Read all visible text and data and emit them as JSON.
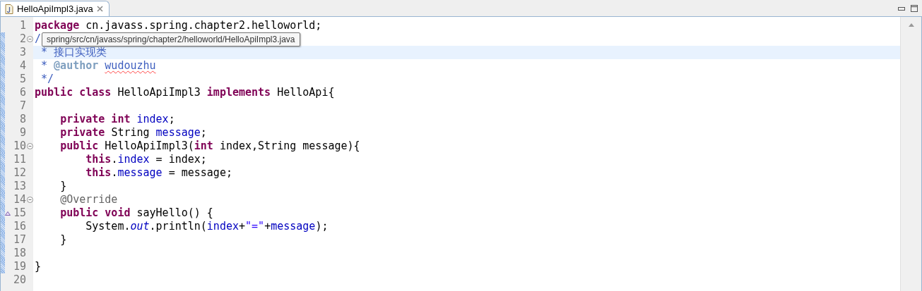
{
  "tab": {
    "title": "HelloApiImpl3.java",
    "selected": true
  },
  "tooltip": "spring/src/cn/javass/spring/chapter2/helloworld/HelloApiImpl3.java",
  "lines": [
    {
      "number": "1",
      "selected": false,
      "changed": false,
      "fold": false,
      "override": false,
      "tokens": [
        {
          "kind": "keyword",
          "text": "package "
        },
        {
          "kind": "plain",
          "text": "cn.javass.spring.chapter2.helloworld;"
        }
      ]
    },
    {
      "number": "2",
      "selected": false,
      "changed": true,
      "fold": true,
      "override": false,
      "tokens": [
        {
          "kind": "doc",
          "text": "/"
        }
      ]
    },
    {
      "number": "3",
      "selected": true,
      "changed": true,
      "fold": false,
      "override": false,
      "tokens": [
        {
          "kind": "doc",
          "text": " * 接口实现类"
        }
      ]
    },
    {
      "number": "4",
      "selected": false,
      "changed": true,
      "fold": false,
      "override": false,
      "tokens": [
        {
          "kind": "doc",
          "text": " * "
        },
        {
          "kind": "doctag",
          "text": "@author "
        },
        {
          "kind": "doc",
          "text": "wudouzhu",
          "misspelled": true
        }
      ]
    },
    {
      "number": "5",
      "selected": false,
      "changed": true,
      "fold": false,
      "override": false,
      "tokens": [
        {
          "kind": "doc",
          "text": " */"
        }
      ]
    },
    {
      "number": "6",
      "selected": false,
      "changed": true,
      "fold": false,
      "override": false,
      "tokens": [
        {
          "kind": "keyword",
          "text": "public class "
        },
        {
          "kind": "plain",
          "text": "HelloApiImpl3 "
        },
        {
          "kind": "keyword",
          "text": "implements "
        },
        {
          "kind": "plain",
          "text": "HelloApi{"
        }
      ]
    },
    {
      "number": "7",
      "selected": false,
      "changed": true,
      "fold": false,
      "override": false
    },
    {
      "number": "8",
      "selected": false,
      "changed": true,
      "fold": false,
      "override": false,
      "tokens": [
        {
          "kind": "keyword",
          "text": "    private int "
        },
        {
          "kind": "field",
          "text": "index"
        },
        {
          "kind": "plain",
          "text": ";"
        }
      ]
    },
    {
      "number": "9",
      "selected": false,
      "changed": true,
      "fold": false,
      "override": false,
      "tokens": [
        {
          "kind": "keyword",
          "text": "    private "
        },
        {
          "kind": "plain",
          "text": "String "
        },
        {
          "kind": "field",
          "text": "message"
        },
        {
          "kind": "plain",
          "text": ";"
        }
      ]
    },
    {
      "number": "10",
      "selected": false,
      "changed": true,
      "fold": true,
      "override": false,
      "tokens": [
        {
          "kind": "keyword",
          "text": "    public "
        },
        {
          "kind": "plain",
          "text": "HelloApiImpl3("
        },
        {
          "kind": "keyword",
          "text": "int "
        },
        {
          "kind": "plain",
          "text": "index,String message){"
        }
      ]
    },
    {
      "number": "11",
      "selected": false,
      "changed": true,
      "fold": false,
      "override": false,
      "tokens": [
        {
          "kind": "keyword",
          "text": "        this"
        },
        {
          "kind": "plain",
          "text": "."
        },
        {
          "kind": "field",
          "text": "index"
        },
        {
          "kind": "plain",
          "text": " = index;"
        }
      ]
    },
    {
      "number": "12",
      "selected": false,
      "changed": true,
      "fold": false,
      "override": false,
      "tokens": [
        {
          "kind": "keyword",
          "text": "        this"
        },
        {
          "kind": "plain",
          "text": "."
        },
        {
          "kind": "field",
          "text": "message"
        },
        {
          "kind": "plain",
          "text": " = message;"
        }
      ]
    },
    {
      "number": "13",
      "selected": false,
      "changed": true,
      "fold": false,
      "override": false,
      "tokens": [
        {
          "kind": "plain",
          "text": "    }"
        }
      ]
    },
    {
      "number": "14",
      "selected": false,
      "changed": true,
      "fold": true,
      "override": false,
      "tokens": [
        {
          "kind": "annotation",
          "text": "    @Override"
        }
      ]
    },
    {
      "number": "15",
      "selected": false,
      "changed": true,
      "fold": false,
      "override": true,
      "tokens": [
        {
          "kind": "keyword",
          "text": "    public void "
        },
        {
          "kind": "plain",
          "text": "sayHello() {"
        }
      ]
    },
    {
      "number": "16",
      "selected": false,
      "changed": true,
      "fold": false,
      "override": false,
      "tokens": [
        {
          "kind": "plain",
          "text": "        System."
        },
        {
          "kind": "static",
          "text": "out"
        },
        {
          "kind": "plain",
          "text": ".println("
        },
        {
          "kind": "field",
          "text": "index"
        },
        {
          "kind": "plain",
          "text": "+"
        },
        {
          "kind": "string",
          "text": "\"=\""
        },
        {
          "kind": "plain",
          "text": "+"
        },
        {
          "kind": "field",
          "text": "message"
        },
        {
          "kind": "plain",
          "text": ");"
        }
      ]
    },
    {
      "number": "17",
      "selected": false,
      "changed": true,
      "fold": false,
      "override": false,
      "tokens": [
        {
          "kind": "plain",
          "text": "    }"
        }
      ]
    },
    {
      "number": "18",
      "selected": false,
      "changed": true,
      "fold": false,
      "override": false
    },
    {
      "number": "19",
      "selected": false,
      "changed": true,
      "fold": false,
      "override": false,
      "tokens": [
        {
          "kind": "plain",
          "text": "}"
        }
      ]
    },
    {
      "number": "20",
      "selected": false,
      "changed": false,
      "fold": false,
      "override": false
    }
  ]
}
